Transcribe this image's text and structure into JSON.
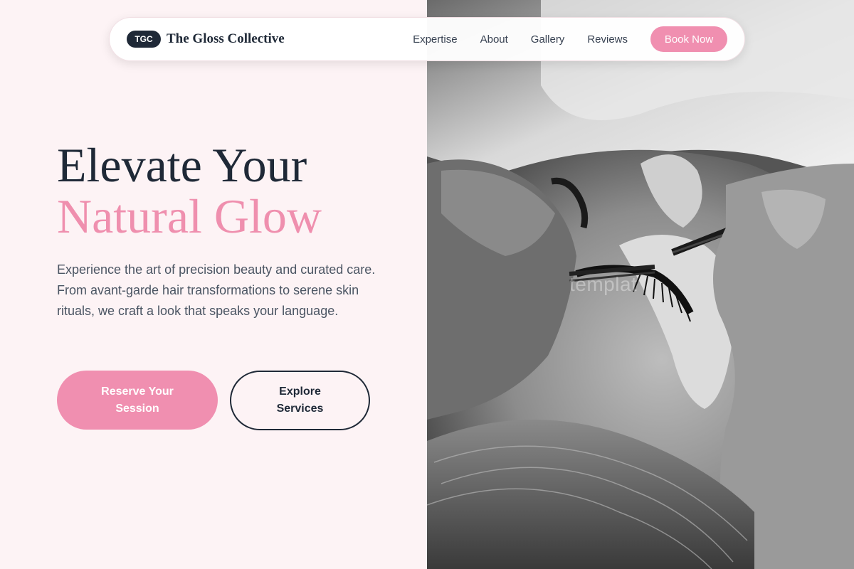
{
  "brand": {
    "badge": "TGC",
    "name": "The Gloss Collective"
  },
  "nav": {
    "links": [
      "Expertise",
      "About",
      "Gallery",
      "Reviews"
    ],
    "cta": "Book Now"
  },
  "hero": {
    "title_line1": "Elevate Your",
    "title_line2": "Natural Glow",
    "description": "Experience the art of precision beauty and curated care. From avant-garde hair transformations to serene skin rituals, we craft a look that speaks your language.",
    "primary_button": "Reserve Your Session",
    "secondary_button": "Explore Services"
  },
  "image": {
    "watermark": "templat"
  },
  "colors": {
    "accent": "#f08fb0",
    "dark": "#1f2937",
    "background": "#fdf3f5"
  }
}
